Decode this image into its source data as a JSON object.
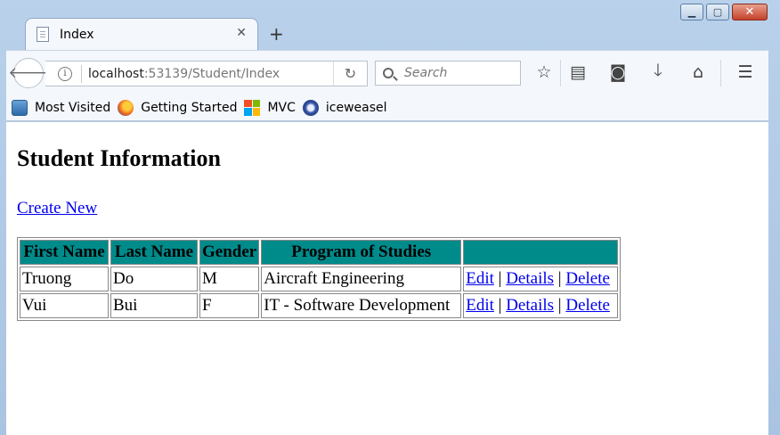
{
  "browser": {
    "tab": {
      "title": "Index"
    },
    "url": {
      "host": "localhost",
      "rest": ":53139/Student/Index"
    },
    "search": {
      "placeholder": "Search"
    },
    "bookmarks": [
      {
        "label": "Most Visited",
        "icon": "most-visited-icon"
      },
      {
        "label": "Getting Started",
        "icon": "firefox-icon"
      },
      {
        "label": "MVC",
        "icon": "mvc-icon"
      },
      {
        "label": "iceweasel",
        "icon": "iceweasel-icon"
      }
    ]
  },
  "page": {
    "title": "Student Information",
    "create_link": "Create New",
    "table": {
      "headers": [
        "First Name",
        "Last Name",
        "Gender",
        "Program of Studies",
        ""
      ],
      "header_color": "#008b8b",
      "rows": [
        {
          "first": "Truong",
          "last": "Do",
          "gender": "M",
          "program": "Aircraft Engineering"
        },
        {
          "first": "Vui",
          "last": "Bui",
          "gender": "F",
          "program": "IT - Software Development"
        }
      ],
      "actions": {
        "edit": "Edit",
        "details": "Details",
        "delete": "Delete",
        "separator": "|"
      }
    }
  }
}
